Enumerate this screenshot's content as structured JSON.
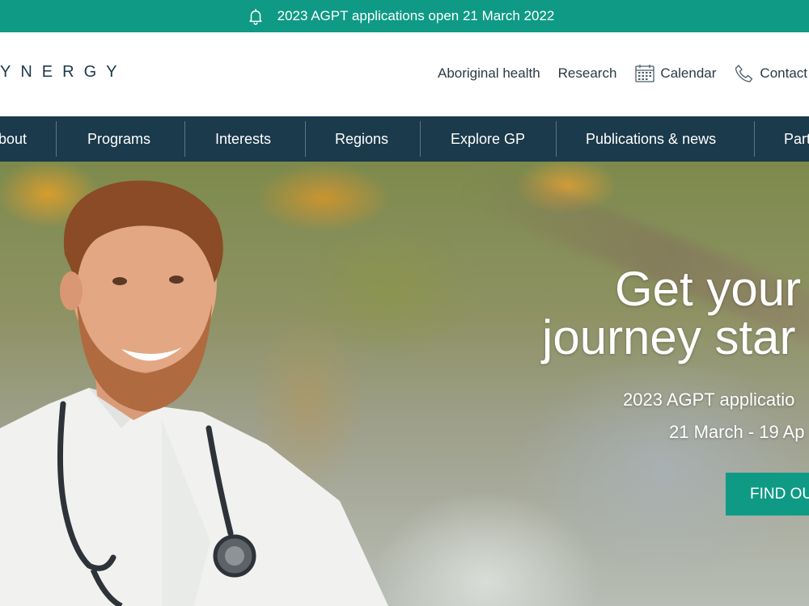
{
  "announcement": {
    "icon": "bell-icon",
    "text": "2023 AGPT applications open 21 March 2022"
  },
  "header": {
    "logo_text": "YNERGY",
    "util_links": [
      {
        "label": "Aboriginal health",
        "icon": ""
      },
      {
        "label": "Research",
        "icon": ""
      },
      {
        "label": "Calendar",
        "icon": "calendar-icon"
      },
      {
        "label": "Contact",
        "icon": "phone-icon"
      }
    ]
  },
  "nav": {
    "items": [
      "bout",
      "Programs",
      "Interests",
      "Regions",
      "Explore GP",
      "Publications & news",
      "Part"
    ]
  },
  "hero": {
    "title_line1": "Get your",
    "title_line2": "journey star",
    "subtitle": "2023 AGPT applicatio",
    "dates": "21 March - 19 Ap",
    "cta_label": "FIND OU"
  },
  "colors": {
    "accent": "#0f9a85",
    "nav_bg": "#1b3a4b",
    "text_dark": "#2b3a44"
  }
}
